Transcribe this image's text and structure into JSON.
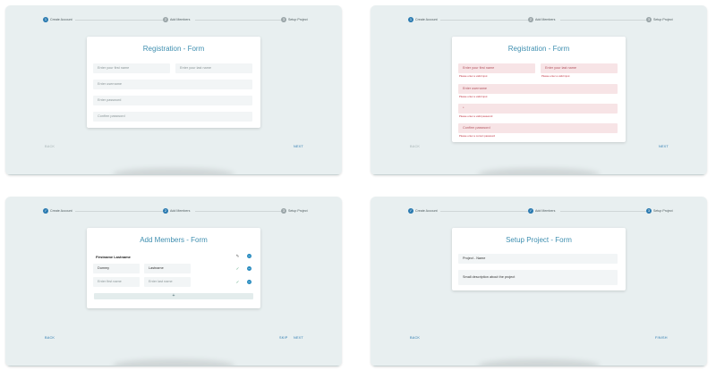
{
  "steps": {
    "create_account": "Create Account",
    "add_members": "Add Members",
    "setup_project": "Setup Project",
    "step2_number": "2",
    "step3_number": "3",
    "check_glyph": "✓"
  },
  "registration": {
    "title": "Registration - Form",
    "first_name_placeholder": "Enter your first name",
    "last_name_placeholder": "Enter your last name",
    "username_placeholder": "Enter username",
    "password_placeholder": "Enter password",
    "confirm_password_placeholder": "Confirm password",
    "step1_number": "1"
  },
  "registration_errors": {
    "password_value": "*",
    "first_name_error": "Please enter a valid input",
    "last_name_error": "Please enter a valid input",
    "username_error": "Please enter a valid input",
    "password_error": "Please enter a valid password",
    "confirm_error": "Please enter a correct password",
    "username_placeholder": "Enter username",
    "confirm_placeholder": "Confirm password"
  },
  "members": {
    "title": "Add Members - Form",
    "row1_name": "Firstname Lastname",
    "row2_first": "Dummy",
    "row2_last": "Lastname",
    "row3_first_placeholder": "Enter first name",
    "row3_last_placeholder": "Enter last name",
    "add_label": "+",
    "pencil_glyph": "✎",
    "check_glyph": "✓",
    "minus_glyph": "−"
  },
  "project": {
    "title": "Setup Project - Form",
    "name_value": "Project - Name",
    "description_value": "Small description about the project"
  },
  "nav": {
    "back": "BACK",
    "next": "NEXT",
    "skip": "SKIP",
    "finish": "FINISH"
  }
}
